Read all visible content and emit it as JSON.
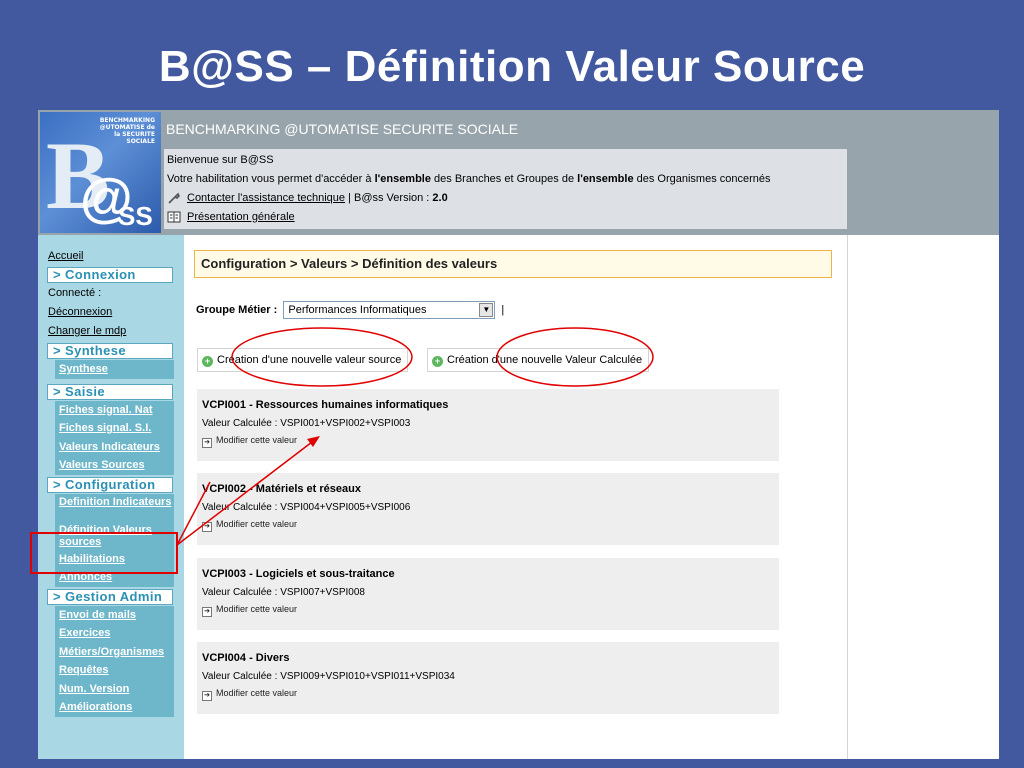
{
  "slide": {
    "title": "B@SS – Définition Valeur Source"
  },
  "header": {
    "logo_text": "BENCHMARKING @UTOMATISE de la SECURITE SOCIALE",
    "logo_b": "B",
    "logo_at": "@",
    "logo_ss": "SS",
    "app_title": "BENCHMARKING @UTOMATISE SECURITE SOCIALE",
    "welcome": "Bienvenue sur B@SS",
    "habilitation_pre": "Votre habilitation vous permet d'accéder à ",
    "habilitation_b1": "l'ensemble",
    "habilitation_mid": " des Branches et Groupes de ",
    "habilitation_b2": "l'ensemble",
    "habilitation_post": " des Organismes concernés",
    "contact_link": "Contacter l'assistance technique",
    "version_label": " | B@ss Version : ",
    "version": "2.0",
    "presentation_link": "Présentation générale"
  },
  "sidebar": {
    "accueil": "Accueil",
    "connexion": {
      "title": "> Connexion",
      "connecte": "Connecté :",
      "deconnexion": "Déconnexion",
      "changer_mdp": "Changer le mdp"
    },
    "synthese": {
      "title": "> Synthese",
      "items": [
        "Synthese"
      ]
    },
    "saisie": {
      "title": "> Saisie",
      "items": [
        "Fiches signal. Nat",
        "Fiches signal. S.I.",
        "Valeurs Indicateurs",
        "Valeurs Sources"
      ]
    },
    "configuration": {
      "title": "> Configuration",
      "items": [
        "Definition Indicateurs",
        "Définition Valeurs sources",
        "Habilitations",
        "Annonces"
      ]
    },
    "gestion": {
      "title": "> Gestion Admin",
      "items": [
        "Envoi de mails",
        "Exercices",
        "Métiers/Organismes",
        "Requêtes",
        "Num. Version",
        "Améliorations"
      ]
    }
  },
  "main": {
    "breadcrumb": "Configuration > Valeurs > Définition des valeurs",
    "groupe_label": "Groupe Métier :",
    "groupe_value": "Performances Informatiques",
    "groupe_pipe": "|",
    "btn_source": "Création d'une nouvelle valeur source",
    "btn_calculee": "Création d'une nouvelle Valeur Calculée",
    "cards": [
      {
        "code": "VCPI001",
        "label": " - Ressources humaines informatiques",
        "formula": "Valeur Calculée : VSPI001+VSPI002+VSPI003",
        "edit": "Modifier cette valeur"
      },
      {
        "code": "VCPI002",
        "label": " - Matériels et réseaux",
        "formula": "Valeur Calculée : VSPI004+VSPI005+VSPI006",
        "edit": "Modifier cette valeur"
      },
      {
        "code": "VCPI003",
        "label": " - Logiciels et sous-traitance",
        "formula": "Valeur Calculée : VSPI007+VSPI008",
        "edit": "Modifier cette valeur"
      },
      {
        "code": "VCPI004",
        "label": " - Divers",
        "formula": "Valeur Calculée : VSPI009+VSPI010+VSPI011+VSPI034",
        "edit": "Modifier cette valeur"
      }
    ]
  },
  "annotations": {
    "ellipse_color": "#e00000",
    "box_color": "#e00000",
    "arrow_color": "#e00000"
  }
}
